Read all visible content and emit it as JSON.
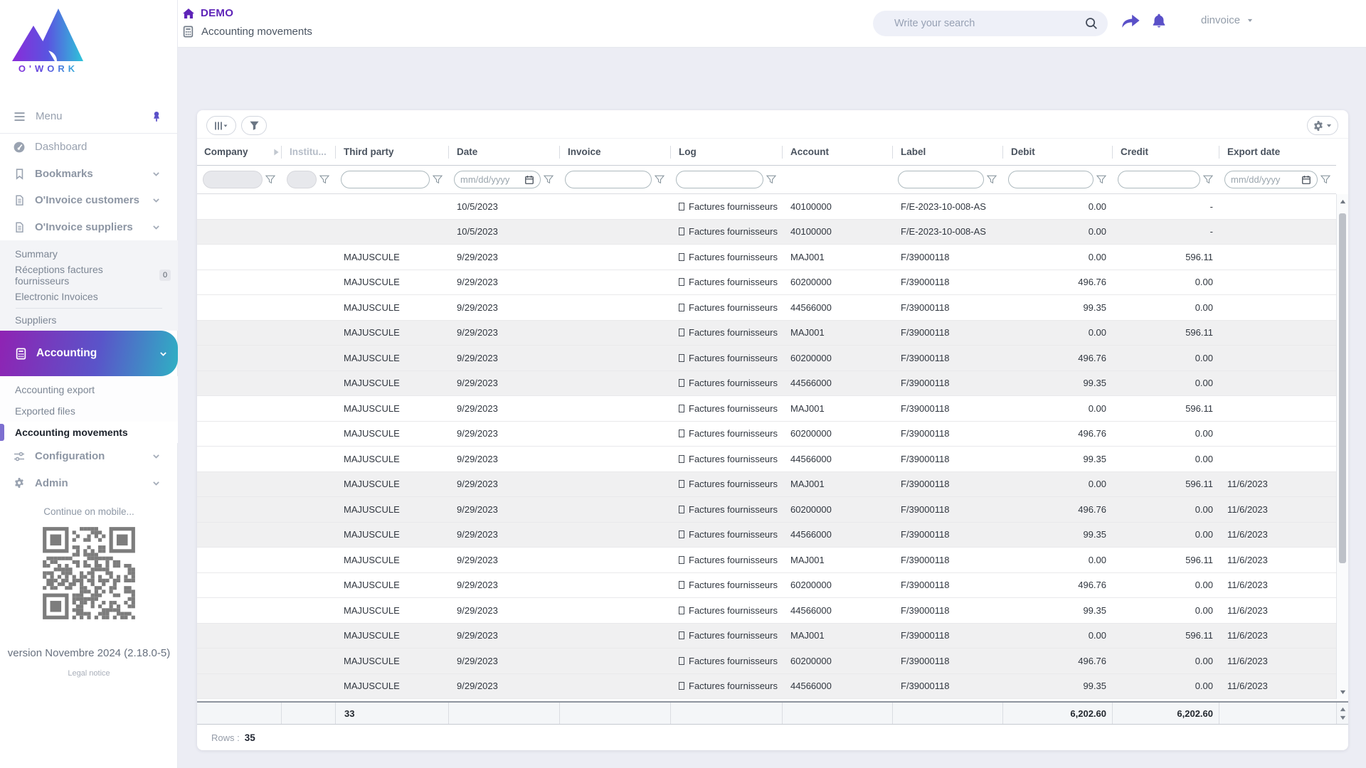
{
  "brand": {
    "wordmark": "O'WORK"
  },
  "topbar": {
    "workspace_label": "DEMO",
    "breadcrumb": "Accounting movements",
    "search_placeholder": "Write your search",
    "username": "dinvoice"
  },
  "sidebar": {
    "menu_label": "Menu",
    "items": [
      {
        "type": "link",
        "icon": "dashboard",
        "label": "Dashboard"
      },
      {
        "type": "section",
        "icon": "bookmark",
        "label": "Bookmarks",
        "chevron": true
      },
      {
        "type": "section",
        "icon": "invoice",
        "label": "O'Invoice customers",
        "chevron": true
      },
      {
        "type": "section",
        "icon": "invoice",
        "label": "O'Invoice suppliers",
        "chevron": true
      },
      {
        "type": "submenu",
        "items": [
          {
            "label": "Summary"
          },
          {
            "label": "Réceptions factures fournisseurs",
            "badge": "0"
          },
          {
            "label": "Electronic Invoices",
            "divider_after": true
          },
          {
            "label": "Suppliers"
          }
        ]
      },
      {
        "type": "section-active",
        "icon": "calculator",
        "label": "Accounting",
        "chevron": true
      },
      {
        "type": "submenu-light",
        "items": [
          {
            "label": "Accounting export"
          },
          {
            "label": "Exported files"
          },
          {
            "label": "Accounting movements",
            "active": true
          }
        ]
      },
      {
        "type": "section",
        "icon": "sliders",
        "label": "Configuration",
        "chevron": true
      },
      {
        "type": "section",
        "icon": "gear",
        "label": "Admin",
        "chevron": true
      }
    ],
    "mobile_hint": "Continue on mobile...",
    "version": "version Novembre 2024 (2.18.0-5)",
    "legal": "Legal notice"
  },
  "grid": {
    "columns": [
      {
        "key": "company",
        "label": "Company",
        "filter": "disabled"
      },
      {
        "key": "institution",
        "label": "Institu...",
        "filter": "disabled",
        "muted": true
      },
      {
        "key": "third_party",
        "label": "Third party",
        "filter": "text"
      },
      {
        "key": "date",
        "label": "Date",
        "filter": "date"
      },
      {
        "key": "invoice",
        "label": "Invoice",
        "filter": "text"
      },
      {
        "key": "log",
        "label": "Log",
        "filter": "text"
      },
      {
        "key": "account",
        "label": "Account",
        "filter": "none"
      },
      {
        "key": "label",
        "label": "Label",
        "filter": "text"
      },
      {
        "key": "debit",
        "label": "Debit",
        "filter": "text",
        "align": "right"
      },
      {
        "key": "credit",
        "label": "Credit",
        "filter": "text",
        "align": "right"
      },
      {
        "key": "export_date",
        "label": "Export date",
        "filter": "date"
      }
    ],
    "date_placeholder": "mm/dd/yyyy",
    "rows": [
      {
        "company": "",
        "institution": "",
        "third_party": "",
        "date": "10/5/2023",
        "invoice": "",
        "log": "Factures fournisseurs",
        "account": "40100000",
        "label": "F/E-2023-10-008-AS",
        "debit": "0.00",
        "credit": "-",
        "export_date": ""
      },
      {
        "company": "",
        "institution": "",
        "third_party": "",
        "date": "10/5/2023",
        "invoice": "",
        "log": "Factures fournisseurs",
        "account": "40100000",
        "label": "F/E-2023-10-008-AS",
        "debit": "0.00",
        "credit": "-",
        "export_date": ""
      },
      {
        "company": "",
        "institution": "",
        "third_party": "MAJUSCULE",
        "date": "9/29/2023",
        "invoice": "",
        "log": "Factures fournisseurs",
        "account": "MAJ001",
        "label": "F/39000118",
        "debit": "0.00",
        "credit": "596.11",
        "export_date": ""
      },
      {
        "company": "",
        "institution": "",
        "third_party": "MAJUSCULE",
        "date": "9/29/2023",
        "invoice": "",
        "log": "Factures fournisseurs",
        "account": "60200000",
        "label": "F/39000118",
        "debit": "496.76",
        "credit": "0.00",
        "export_date": ""
      },
      {
        "company": "",
        "institution": "",
        "third_party": "MAJUSCULE",
        "date": "9/29/2023",
        "invoice": "",
        "log": "Factures fournisseurs",
        "account": "44566000",
        "label": "F/39000118",
        "debit": "99.35",
        "credit": "0.00",
        "export_date": ""
      },
      {
        "company": "",
        "institution": "",
        "third_party": "MAJUSCULE",
        "date": "9/29/2023",
        "invoice": "",
        "log": "Factures fournisseurs",
        "account": "MAJ001",
        "label": "F/39000118",
        "debit": "0.00",
        "credit": "596.11",
        "export_date": ""
      },
      {
        "company": "",
        "institution": "",
        "third_party": "MAJUSCULE",
        "date": "9/29/2023",
        "invoice": "",
        "log": "Factures fournisseurs",
        "account": "60200000",
        "label": "F/39000118",
        "debit": "496.76",
        "credit": "0.00",
        "export_date": ""
      },
      {
        "company": "",
        "institution": "",
        "third_party": "MAJUSCULE",
        "date": "9/29/2023",
        "invoice": "",
        "log": "Factures fournisseurs",
        "account": "44566000",
        "label": "F/39000118",
        "debit": "99.35",
        "credit": "0.00",
        "export_date": ""
      },
      {
        "company": "",
        "institution": "",
        "third_party": "MAJUSCULE",
        "date": "9/29/2023",
        "invoice": "",
        "log": "Factures fournisseurs",
        "account": "MAJ001",
        "label": "F/39000118",
        "debit": "0.00",
        "credit": "596.11",
        "export_date": ""
      },
      {
        "company": "",
        "institution": "",
        "third_party": "MAJUSCULE",
        "date": "9/29/2023",
        "invoice": "",
        "log": "Factures fournisseurs",
        "account": "60200000",
        "label": "F/39000118",
        "debit": "496.76",
        "credit": "0.00",
        "export_date": ""
      },
      {
        "company": "",
        "institution": "",
        "third_party": "MAJUSCULE",
        "date": "9/29/2023",
        "invoice": "",
        "log": "Factures fournisseurs",
        "account": "44566000",
        "label": "F/39000118",
        "debit": "99.35",
        "credit": "0.00",
        "export_date": ""
      },
      {
        "company": "",
        "institution": "",
        "third_party": "MAJUSCULE",
        "date": "9/29/2023",
        "invoice": "",
        "log": "Factures fournisseurs",
        "account": "MAJ001",
        "label": "F/39000118",
        "debit": "0.00",
        "credit": "596.11",
        "export_date": "11/6/2023"
      },
      {
        "company": "",
        "institution": "",
        "third_party": "MAJUSCULE",
        "date": "9/29/2023",
        "invoice": "",
        "log": "Factures fournisseurs",
        "account": "60200000",
        "label": "F/39000118",
        "debit": "496.76",
        "credit": "0.00",
        "export_date": "11/6/2023"
      },
      {
        "company": "",
        "institution": "",
        "third_party": "MAJUSCULE",
        "date": "9/29/2023",
        "invoice": "",
        "log": "Factures fournisseurs",
        "account": "44566000",
        "label": "F/39000118",
        "debit": "99.35",
        "credit": "0.00",
        "export_date": "11/6/2023"
      },
      {
        "company": "",
        "institution": "",
        "third_party": "MAJUSCULE",
        "date": "9/29/2023",
        "invoice": "",
        "log": "Factures fournisseurs",
        "account": "MAJ001",
        "label": "F/39000118",
        "debit": "0.00",
        "credit": "596.11",
        "export_date": "11/6/2023"
      },
      {
        "company": "",
        "institution": "",
        "third_party": "MAJUSCULE",
        "date": "9/29/2023",
        "invoice": "",
        "log": "Factures fournisseurs",
        "account": "60200000",
        "label": "F/39000118",
        "debit": "496.76",
        "credit": "0.00",
        "export_date": "11/6/2023"
      },
      {
        "company": "",
        "institution": "",
        "third_party": "MAJUSCULE",
        "date": "9/29/2023",
        "invoice": "",
        "log": "Factures fournisseurs",
        "account": "44566000",
        "label": "F/39000118",
        "debit": "99.35",
        "credit": "0.00",
        "export_date": "11/6/2023"
      },
      {
        "company": "",
        "institution": "",
        "third_party": "MAJUSCULE",
        "date": "9/29/2023",
        "invoice": "",
        "log": "Factures fournisseurs",
        "account": "MAJ001",
        "label": "F/39000118",
        "debit": "0.00",
        "credit": "596.11",
        "export_date": "11/6/2023"
      },
      {
        "company": "",
        "institution": "",
        "third_party": "MAJUSCULE",
        "date": "9/29/2023",
        "invoice": "",
        "log": "Factures fournisseurs",
        "account": "60200000",
        "label": "F/39000118",
        "debit": "496.76",
        "credit": "0.00",
        "export_date": "11/6/2023"
      },
      {
        "company": "",
        "institution": "",
        "third_party": "MAJUSCULE",
        "date": "9/29/2023",
        "invoice": "",
        "log": "Factures fournisseurs",
        "account": "44566000",
        "label": "F/39000118",
        "debit": "99.35",
        "credit": "0.00",
        "export_date": "11/6/2023"
      }
    ],
    "totals": {
      "third_party": "33",
      "debit": "6,202.60",
      "credit": "6,202.60"
    },
    "rows_label": "Rows :",
    "rows_count": "35"
  },
  "colors": {
    "accent_purple": "#5a50c8",
    "brand_purple": "#5e24b8",
    "gradient_start": "#8f23b3",
    "gradient_end": "#2fb0c4"
  }
}
